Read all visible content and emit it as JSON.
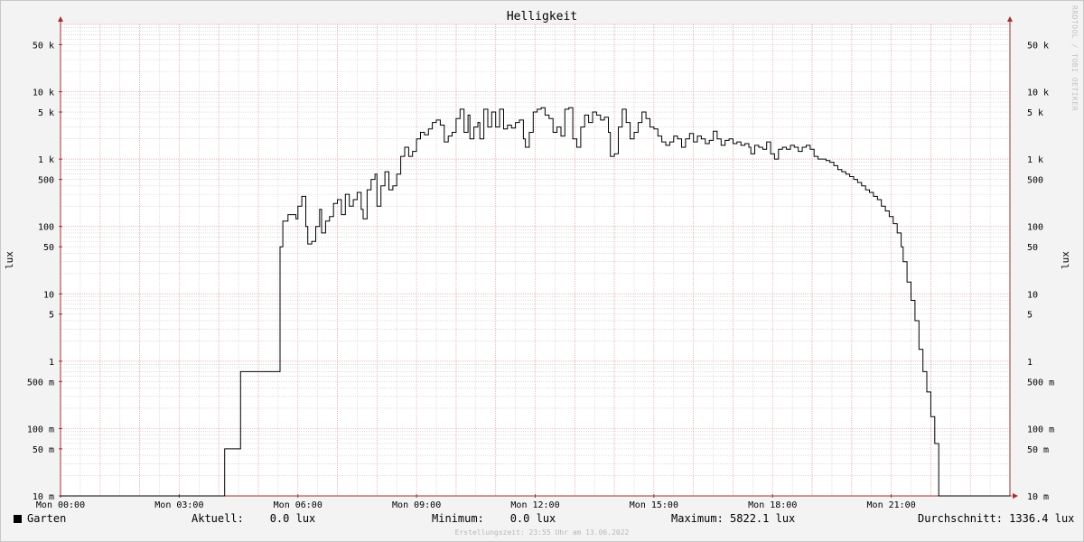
{
  "chart_data": {
    "type": "line",
    "title": "Helligkeit",
    "ylabel": "lux",
    "y_scale": "log",
    "ylim": [
      0.01,
      100000
    ],
    "xlim_hours": [
      0,
      24
    ],
    "y_ticks": [
      {
        "value": 0.01,
        "label": "10 m"
      },
      {
        "value": 0.05,
        "label": "50 m"
      },
      {
        "value": 0.1,
        "label": "100 m"
      },
      {
        "value": 0.5,
        "label": "500 m"
      },
      {
        "value": 1,
        "label": "1"
      },
      {
        "value": 5,
        "label": "5"
      },
      {
        "value": 10,
        "label": "10"
      },
      {
        "value": 50,
        "label": "50"
      },
      {
        "value": 100,
        "label": "100"
      },
      {
        "value": 500,
        "label": "500"
      },
      {
        "value": 1000,
        "label": "1 k"
      },
      {
        "value": 5000,
        "label": "5 k"
      },
      {
        "value": 10000,
        "label": "10 k"
      },
      {
        "value": 50000,
        "label": "50 k"
      }
    ],
    "x_ticks": [
      {
        "value": 0,
        "label": "Mon 00:00"
      },
      {
        "value": 3,
        "label": "Mon 03:00"
      },
      {
        "value": 6,
        "label": "Mon 06:00"
      },
      {
        "value": 9,
        "label": "Mon 09:00"
      },
      {
        "value": 12,
        "label": "Mon 12:00"
      },
      {
        "value": 15,
        "label": "Mon 15:00"
      },
      {
        "value": 18,
        "label": "Mon 18:00"
      },
      {
        "value": 21,
        "label": "Mon 21:00"
      }
    ],
    "grid": true,
    "series": [
      {
        "name": "Garten",
        "color": "#000000",
        "points": [
          [
            0.0,
            0
          ],
          [
            4.15,
            0
          ],
          [
            4.15,
            0.05
          ],
          [
            4.55,
            0.05
          ],
          [
            4.55,
            0.7
          ],
          [
            5.55,
            0.7
          ],
          [
            5.55,
            50
          ],
          [
            5.62,
            50
          ],
          [
            5.62,
            120
          ],
          [
            5.75,
            150
          ],
          [
            5.95,
            130
          ],
          [
            6.0,
            200
          ],
          [
            6.1,
            280
          ],
          [
            6.2,
            100
          ],
          [
            6.25,
            55
          ],
          [
            6.35,
            60
          ],
          [
            6.45,
            100
          ],
          [
            6.55,
            180
          ],
          [
            6.6,
            80
          ],
          [
            6.7,
            120
          ],
          [
            6.8,
            140
          ],
          [
            6.9,
            220
          ],
          [
            7.0,
            250
          ],
          [
            7.1,
            150
          ],
          [
            7.2,
            300
          ],
          [
            7.3,
            200
          ],
          [
            7.4,
            250
          ],
          [
            7.5,
            320
          ],
          [
            7.6,
            180
          ],
          [
            7.65,
            130
          ],
          [
            7.75,
            350
          ],
          [
            7.85,
            500
          ],
          [
            7.95,
            600
          ],
          [
            8.0,
            200
          ],
          [
            8.1,
            400
          ],
          [
            8.2,
            650
          ],
          [
            8.3,
            350
          ],
          [
            8.4,
            400
          ],
          [
            8.5,
            600
          ],
          [
            8.6,
            1100
          ],
          [
            8.7,
            1500
          ],
          [
            8.8,
            1100
          ],
          [
            8.9,
            1300
          ],
          [
            9.0,
            2000
          ],
          [
            9.1,
            2500
          ],
          [
            9.2,
            2300
          ],
          [
            9.3,
            2800
          ],
          [
            9.4,
            3500
          ],
          [
            9.5,
            3800
          ],
          [
            9.6,
            3200
          ],
          [
            9.7,
            1800
          ],
          [
            9.8,
            2200
          ],
          [
            9.9,
            2500
          ],
          [
            10.0,
            4000
          ],
          [
            10.1,
            5500
          ],
          [
            10.2,
            2500
          ],
          [
            10.3,
            4500
          ],
          [
            10.35,
            2000
          ],
          [
            10.45,
            3000
          ],
          [
            10.55,
            3500
          ],
          [
            10.6,
            2000
          ],
          [
            10.7,
            5500
          ],
          [
            10.8,
            3000
          ],
          [
            10.9,
            5000
          ],
          [
            11.0,
            3000
          ],
          [
            11.1,
            5500
          ],
          [
            11.2,
            2800
          ],
          [
            11.3,
            3200
          ],
          [
            11.4,
            2900
          ],
          [
            11.5,
            3500
          ],
          [
            11.6,
            3800
          ],
          [
            11.7,
            2000
          ],
          [
            11.75,
            1500
          ],
          [
            11.85,
            2500
          ],
          [
            11.95,
            5000
          ],
          [
            12.05,
            5500
          ],
          [
            12.15,
            5800
          ],
          [
            12.25,
            4500
          ],
          [
            12.35,
            4000
          ],
          [
            12.45,
            2500
          ],
          [
            12.55,
            3000
          ],
          [
            12.65,
            2200
          ],
          [
            12.75,
            5500
          ],
          [
            12.85,
            5800
          ],
          [
            12.95,
            2000
          ],
          [
            13.05,
            1500
          ],
          [
            13.15,
            3000
          ],
          [
            13.25,
            4500
          ],
          [
            13.35,
            3500
          ],
          [
            13.45,
            5000
          ],
          [
            13.55,
            4500
          ],
          [
            13.65,
            3800
          ],
          [
            13.75,
            4200
          ],
          [
            13.85,
            2500
          ],
          [
            13.9,
            1100
          ],
          [
            14.0,
            1200
          ],
          [
            14.1,
            3000
          ],
          [
            14.2,
            5500
          ],
          [
            14.3,
            3500
          ],
          [
            14.4,
            2000
          ],
          [
            14.5,
            2500
          ],
          [
            14.6,
            3500
          ],
          [
            14.7,
            5000
          ],
          [
            14.8,
            4000
          ],
          [
            14.9,
            3000
          ],
          [
            15.0,
            2800
          ],
          [
            15.1,
            2200
          ],
          [
            15.2,
            1800
          ],
          [
            15.3,
            1600
          ],
          [
            15.4,
            1800
          ],
          [
            15.5,
            2200
          ],
          [
            15.6,
            2000
          ],
          [
            15.7,
            1500
          ],
          [
            15.8,
            2000
          ],
          [
            15.9,
            2400
          ],
          [
            16.0,
            1800
          ],
          [
            16.1,
            2200
          ],
          [
            16.2,
            2000
          ],
          [
            16.3,
            1700
          ],
          [
            16.4,
            1900
          ],
          [
            16.5,
            2600
          ],
          [
            16.6,
            2000
          ],
          [
            16.7,
            1600
          ],
          [
            16.8,
            1900
          ],
          [
            16.9,
            2000
          ],
          [
            17.0,
            1700
          ],
          [
            17.1,
            1800
          ],
          [
            17.2,
            1600
          ],
          [
            17.3,
            1700
          ],
          [
            17.4,
            1500
          ],
          [
            17.45,
            1200
          ],
          [
            17.55,
            1600
          ],
          [
            17.65,
            1500
          ],
          [
            17.75,
            1400
          ],
          [
            17.85,
            1800
          ],
          [
            17.95,
            1200
          ],
          [
            18.05,
            1000
          ],
          [
            18.15,
            1400
          ],
          [
            18.25,
            1500
          ],
          [
            18.35,
            1400
          ],
          [
            18.45,
            1600
          ],
          [
            18.55,
            1500
          ],
          [
            18.65,
            1300
          ],
          [
            18.75,
            1500
          ],
          [
            18.85,
            1600
          ],
          [
            18.95,
            1400
          ],
          [
            19.05,
            1100
          ],
          [
            19.15,
            1000
          ],
          [
            19.25,
            1000
          ],
          [
            19.35,
            950
          ],
          [
            19.45,
            900
          ],
          [
            19.55,
            800
          ],
          [
            19.65,
            700
          ],
          [
            19.75,
            650
          ],
          [
            19.85,
            600
          ],
          [
            19.95,
            550
          ],
          [
            20.05,
            500
          ],
          [
            20.15,
            450
          ],
          [
            20.25,
            400
          ],
          [
            20.35,
            350
          ],
          [
            20.45,
            320
          ],
          [
            20.55,
            280
          ],
          [
            20.65,
            250
          ],
          [
            20.75,
            200
          ],
          [
            20.85,
            170
          ],
          [
            20.95,
            140
          ],
          [
            21.05,
            110
          ],
          [
            21.15,
            80
          ],
          [
            21.25,
            50
          ],
          [
            21.3,
            30
          ],
          [
            21.4,
            15
          ],
          [
            21.5,
            8
          ],
          [
            21.6,
            4
          ],
          [
            21.7,
            1.5
          ],
          [
            21.8,
            0.7
          ],
          [
            21.9,
            0.35
          ],
          [
            22.0,
            0.15
          ],
          [
            22.1,
            0.06
          ],
          [
            22.2,
            0.05
          ],
          [
            22.2,
            0
          ],
          [
            24.0,
            0
          ]
        ]
      }
    ],
    "legend": {
      "series_label": "Garten",
      "current": "Aktuell:    0.0 lux",
      "minimum": "Minimum:    0.0 lux",
      "maximum": "Maximum: 5822.1 lux",
      "average": "Durchschnitt: 1336.4 lux"
    }
  },
  "watermark": "RRDTOOL / TOBI OETIKER",
  "footer": "Erstellungszeit: 23:55 Uhr am 13.06.2022",
  "colors": {
    "background": "#f3f3f3",
    "plot_background": "#ffffff",
    "major_grid": "#e0a0a0",
    "minor_grid": "#cccccc",
    "axis": "#a03030",
    "line": "#000000"
  }
}
